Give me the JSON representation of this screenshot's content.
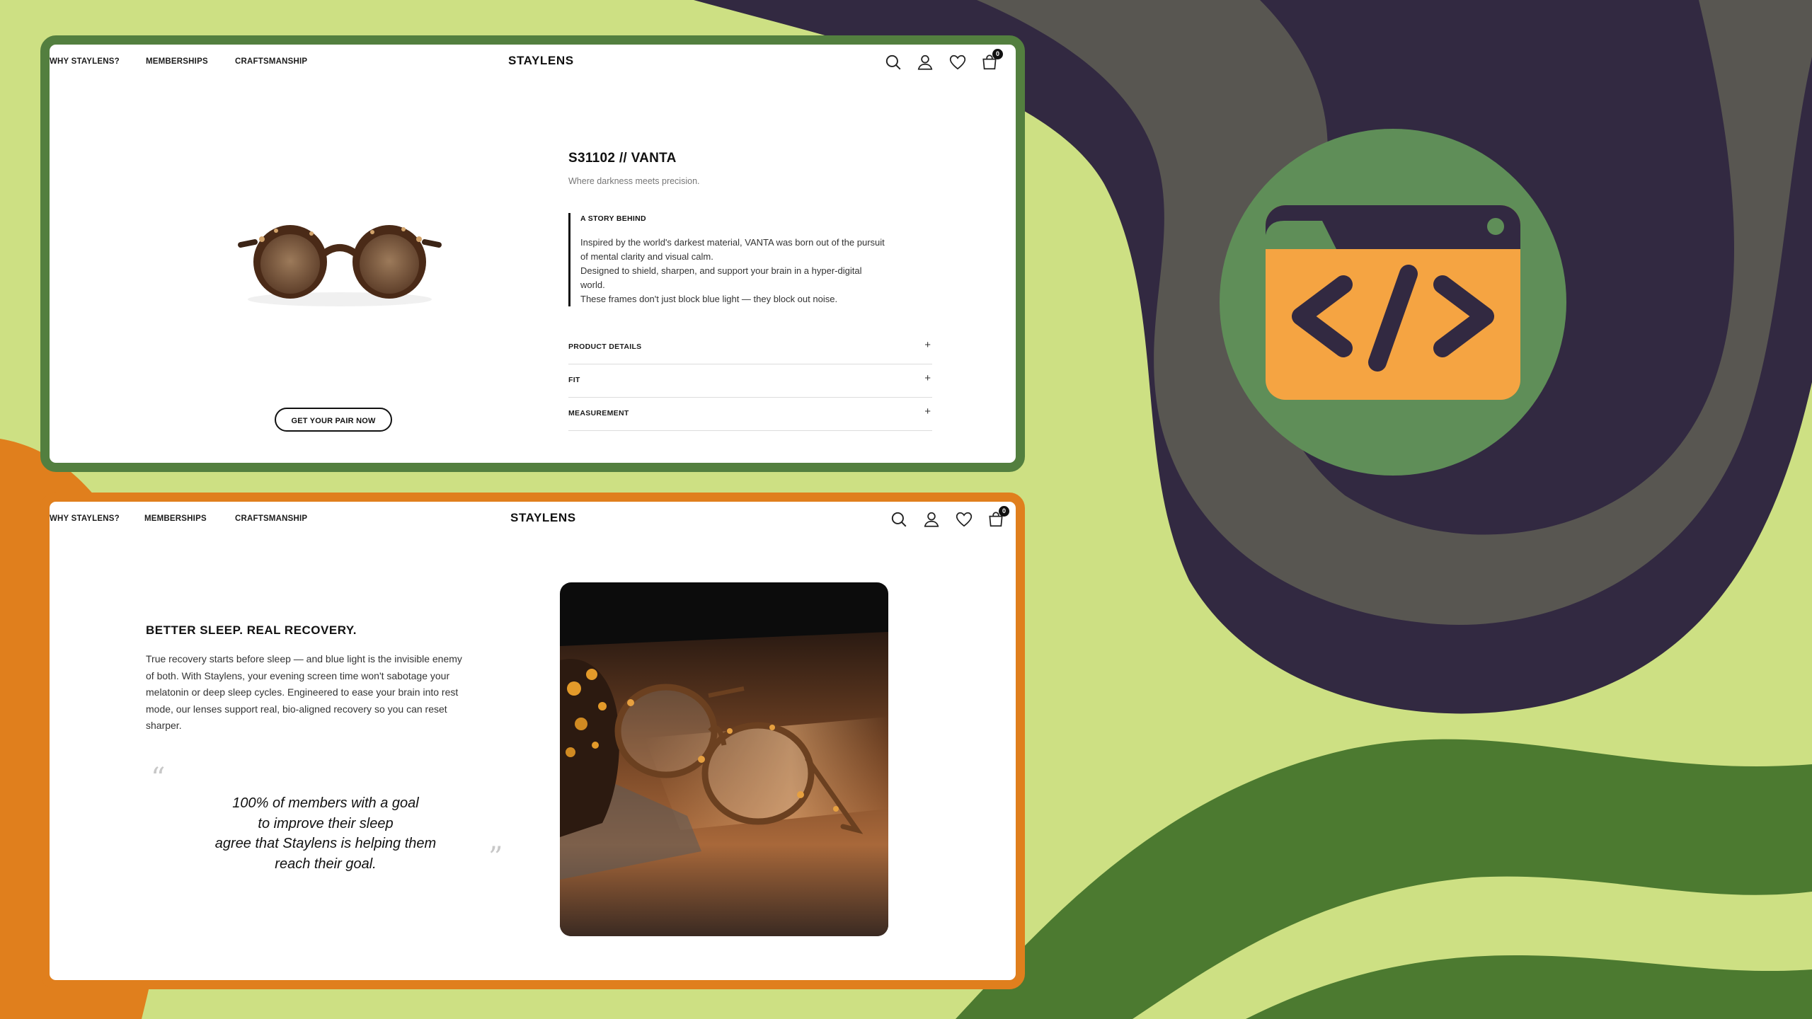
{
  "nav": {
    "links": [
      "WHY STAYLENS?",
      "MEMBERSHIPS",
      "CRAFTSMANSHIP"
    ],
    "brand": "STAYLENS",
    "cart_count": "0"
  },
  "product": {
    "title": "S31102 // VANTA",
    "subtitle": "Where darkness meets precision.",
    "story_heading": "A STORY BEHIND",
    "story_lines": [
      "Inspired by the world's darkest material, VANTA was born out of the pursuit",
      "of mental clarity and visual calm.",
      "Designed to shield, sharpen, and support your brain in a hyper-digital",
      "world.",
      "These frames don't just block blue light — they block out noise."
    ],
    "accordion": [
      "PRODUCT DETAILS",
      "FIT",
      "MEASUREMENT"
    ],
    "accordion_symbol": "+",
    "cta": "GET YOUR PAIR NOW"
  },
  "sleep": {
    "title": "BETTER SLEEP. REAL RECOVERY.",
    "body_lines": [
      "True recovery starts before sleep — and blue light is the invisible enemy",
      "of both. With Staylens, your evening screen time won't sabotage your",
      "melatonin or deep sleep cycles. Engineered to ease your brain into rest",
      "mode, our lenses support real, bio-aligned recovery so you can reset",
      "sharper."
    ],
    "quote_open": "“",
    "quote_close": "”",
    "quote_lines": [
      "100% of members with a goal",
      "to improve their sleep",
      "agree that Staylens is helping them",
      "reach their goal."
    ]
  },
  "colors": {
    "background": "#cde083",
    "top_frame": "#537f3f",
    "bottom_frame": "#e07f1d",
    "dark_wave": "#322941",
    "code_icon_body": "#f5a442",
    "code_icon_circle": "#5f8e58"
  },
  "icons": [
    "search-icon",
    "user-icon",
    "heart-icon",
    "cart-icon",
    "code-window-icon"
  ]
}
